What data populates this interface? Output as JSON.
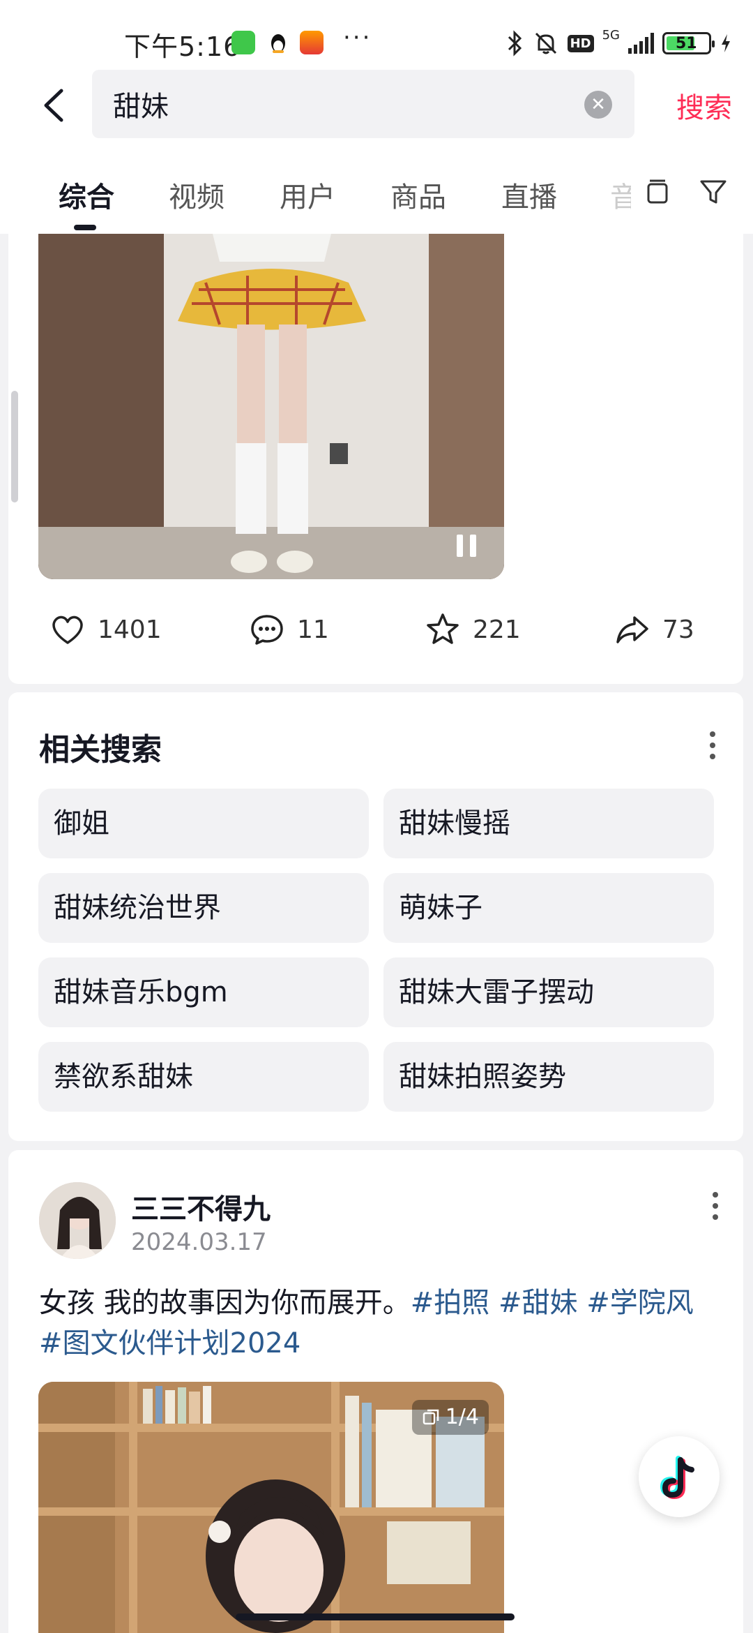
{
  "status_bar": {
    "time": "下午5:16",
    "more": "···",
    "network": "5G",
    "hd": "HD",
    "battery": "51"
  },
  "search": {
    "query": "甜妹",
    "submit_label": "搜索"
  },
  "tabs": [
    {
      "label": "综合"
    },
    {
      "label": "视频"
    },
    {
      "label": "用户"
    },
    {
      "label": "商品"
    },
    {
      "label": "直播"
    },
    {
      "label": "音"
    }
  ],
  "post1": {
    "likes": "1401",
    "comments": "11",
    "favorites": "221",
    "shares": "73"
  },
  "related": {
    "title": "相关搜索",
    "items": [
      {
        "label": "御姐"
      },
      {
        "label": "甜妹慢摇"
      },
      {
        "label": "甜妹统治世界"
      },
      {
        "label": "萌妹子"
      },
      {
        "label": "甜妹音乐bgm"
      },
      {
        "label": "甜妹大雷子摆动"
      },
      {
        "label": "禁欲系甜妹"
      },
      {
        "label": "甜妹拍照姿势"
      }
    ]
  },
  "post2": {
    "author": "三三不得九",
    "date": "2024.03.17",
    "text": "女孩 我的故事因为你而展开。",
    "tags": [
      "#拍照",
      "#甜妹",
      "#学院风",
      "#图文伙伴计划2024"
    ],
    "image_count": "1/4"
  },
  "colors": {
    "accent": "#fe2c55",
    "hashtag": "#2b5a8e",
    "chip_bg": "#f2f2f4"
  }
}
